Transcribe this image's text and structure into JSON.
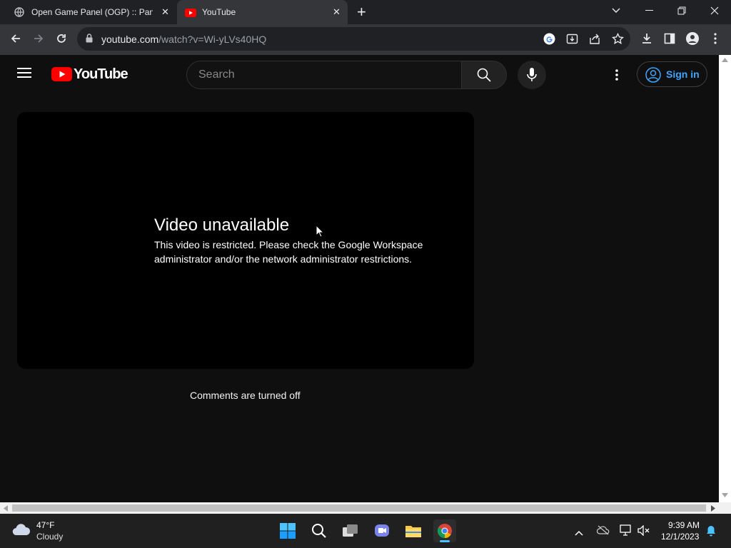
{
  "browser": {
    "tabs": [
      {
        "title": "Open Game Panel (OGP) :: Panel",
        "active": false
      },
      {
        "title": "YouTube",
        "active": true
      }
    ],
    "new_tab_glyph": "+",
    "close_glyph": "✕",
    "url_host": "youtube.com",
    "url_path": "/watch?v=Wi-yLVs40HQ"
  },
  "youtube": {
    "logo_text": "YouTube",
    "search_placeholder": "Search",
    "sign_in_label": "Sign in",
    "error_title": "Video unavailable",
    "error_message": "This video is restricted. Please check the Google Workspace administrator and/or the network administrator restrictions.",
    "comments_status": "Comments are turned off"
  },
  "taskbar": {
    "weather_temp": "47°F",
    "weather_condition": "Cloudy",
    "time": "9:39 AM",
    "date": "12/1/2023"
  },
  "colors": {
    "youtube_red": "#ff0000",
    "signin_blue": "#3ea6ff",
    "page_bg": "#0f0f0f"
  }
}
